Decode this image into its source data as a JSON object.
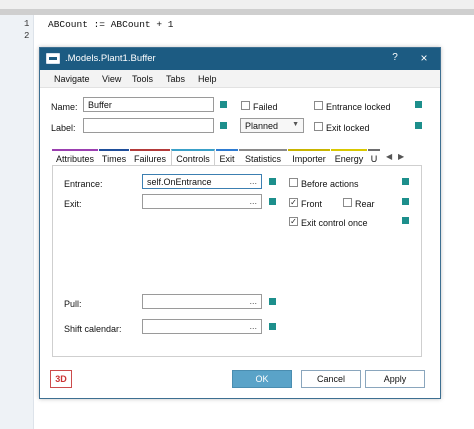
{
  "editor": {
    "line_numbers": [
      "1",
      "2"
    ],
    "code_line_1": "ABCount := ABCount + 1"
  },
  "dialog": {
    "title": ".Models.Plant1.Buffer",
    "help_label": "?",
    "close_label": "×"
  },
  "menu": {
    "items": [
      "Navigate",
      "View",
      "Tools",
      "Tabs",
      "Help"
    ]
  },
  "form": {
    "name_label": "Name:",
    "name_value": "Buffer",
    "label_label": "Label:",
    "label_value": "",
    "failed_label": "Failed",
    "entrance_locked_label": "Entrance locked",
    "planned_value": "Planned",
    "exit_locked_label": "Exit locked"
  },
  "tabs": {
    "items": [
      "Attributes",
      "Times",
      "Failures",
      "Controls",
      "Exit",
      "Statistics",
      "Importer",
      "Energy",
      "U"
    ],
    "active": "Controls",
    "colors": [
      "#9b3fb0",
      "#1f4e9a",
      "#b33a3a",
      "#3aa0c8",
      "#2e7bd1",
      "#8a8a8a",
      "#c8b400",
      "#d9c800",
      "#6e6e6e"
    ]
  },
  "controls": {
    "entrance_label": "Entrance:",
    "entrance_value": "self.OnEntrance",
    "exit_label": "Exit:",
    "exit_value": "",
    "pull_label": "Pull:",
    "pull_value": "",
    "shift_calendar_label": "Shift calendar:",
    "shift_calendar_value": "",
    "before_actions_label": "Before actions",
    "before_actions_checked": false,
    "front_label": "Front",
    "front_checked": true,
    "rear_label": "Rear",
    "rear_checked": false,
    "exit_control_once_label": "Exit control once",
    "exit_control_once_checked": true,
    "dots": "..."
  },
  "footer": {
    "btn_3d": "3D",
    "ok": "OK",
    "cancel": "Cancel",
    "apply": "Apply"
  },
  "colors": {
    "titlebar": "#1c5b82",
    "accent_square": "#1d8f8c",
    "ok_button": "#5aa3c8"
  }
}
